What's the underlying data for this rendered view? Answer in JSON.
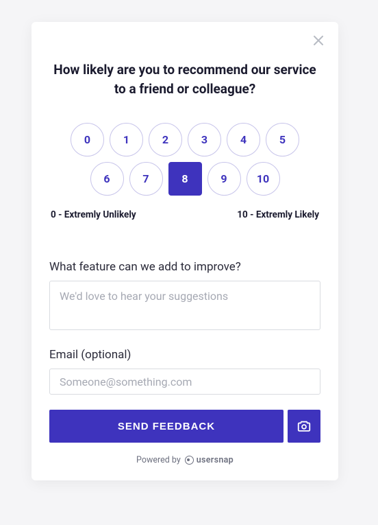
{
  "question": "How likely are you to recommend our service to a friend or colleague?",
  "scale": {
    "options": [
      "0",
      "1",
      "2",
      "3",
      "4",
      "5",
      "6",
      "7",
      "8",
      "9",
      "10"
    ],
    "selected": 8,
    "lowLabel": "0 - Extremly Unlikely",
    "highLabel": "10 - Extremly Likely"
  },
  "feature": {
    "label": "What feature can we add to improve?",
    "placeholder": "We'd love to hear your suggestions",
    "value": ""
  },
  "email": {
    "label": "Email (optional)",
    "placeholder": "Someone@something.com",
    "value": ""
  },
  "actions": {
    "submitLabel": "SEND FEEDBACK"
  },
  "footer": {
    "poweredBy": "Powered by",
    "brand": "usersnap"
  },
  "colors": {
    "accent": "#3e33bd"
  }
}
